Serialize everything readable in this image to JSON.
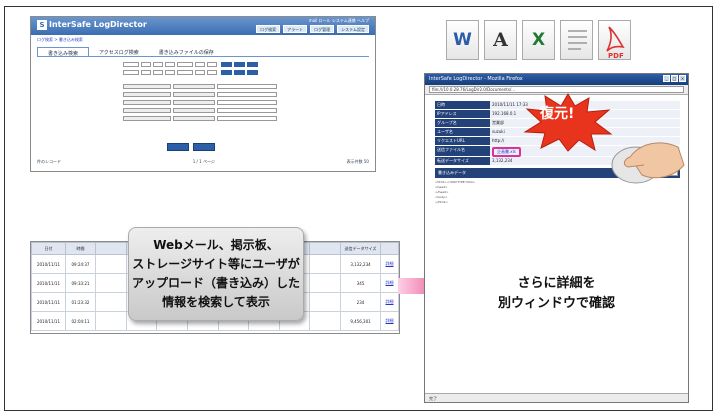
{
  "app": {
    "logo": "InterSafe LogDirector",
    "header_links": [
      "mail",
      "ロール",
      "システム連携",
      "ヘルプ"
    ],
    "header_buttons": [
      "ログ検索",
      "アラート",
      "ログ管理",
      "システム設定"
    ],
    "breadcrumb": "ログ検索 > 書き込み検索",
    "tabs": [
      "書き込み検索",
      "アクセスログ検索",
      "書き込みファイルの保存"
    ],
    "footer_left": "件のレコード",
    "footer_mid": "1 / 1 ページ",
    "footer_right": "表示件数 50"
  },
  "results": {
    "headers": [
      "日付",
      "時間",
      "",
      "",
      "",
      "",
      "",
      "",
      "",
      "",
      "送信データサイズ",
      ""
    ],
    "rows": [
      {
        "date": "2010/11/11",
        "time": "09:24:37",
        "size": "3,132,234",
        "link": "詳細"
      },
      {
        "date": "2010/11/11",
        "time": "09:33:21",
        "size": "345",
        "link": "詳細"
      },
      {
        "date": "2010/11/11",
        "time": "01:23:32",
        "size": "234",
        "link": "詳細"
      },
      {
        "date": "2010/11/11",
        "time": "02:04:11",
        "size": "9,456,301",
        "link": "詳細"
      }
    ]
  },
  "callout": {
    "lines": [
      "Webメール、掲示板、",
      "ストレージサイト等にユーザが",
      "アップロード（書き込み）した",
      "情報を検索して表示"
    ]
  },
  "popup": {
    "title": "InterSafe LogDirector - Mozilla Firefox",
    "url": "file:///10.0.28.76/LogDir2.0/Documents/...",
    "fields": [
      {
        "key": "日時",
        "value": "2010/11/11 17:33"
      },
      {
        "key": "IPアドレス",
        "value": "192.168.0.1"
      },
      {
        "key": "グループ名",
        "value": "営業部"
      },
      {
        "key": "ユーザ名",
        "value": "suzuki"
      },
      {
        "key": "リクエストURL",
        "value": "http://"
      },
      {
        "key": "送信ファイル名",
        "value": "企画書.xls"
      },
      {
        "key": "転送データサイズ",
        "value": "3,132,234"
      }
    ],
    "write_data_label": "書き込みデータ",
    "encoding": "UTF-8",
    "source_lines": [
      "<html><!DOCTYPE html>",
      "<head>",
      "</head>",
      "<body>",
      "</html>"
    ],
    "confirm_lines": [
      "さらに詳細を",
      "別ウィンドウで確認"
    ],
    "status": "完了"
  },
  "restore_label": "復元!",
  "file_icons": [
    "word-icon",
    "text-icon",
    "excel-icon",
    "document-icon",
    "pdf-icon"
  ],
  "colors": {
    "accent_pink": "#e0319b",
    "burst_red": "#e8341c",
    "nav_blue": "#24427a"
  }
}
